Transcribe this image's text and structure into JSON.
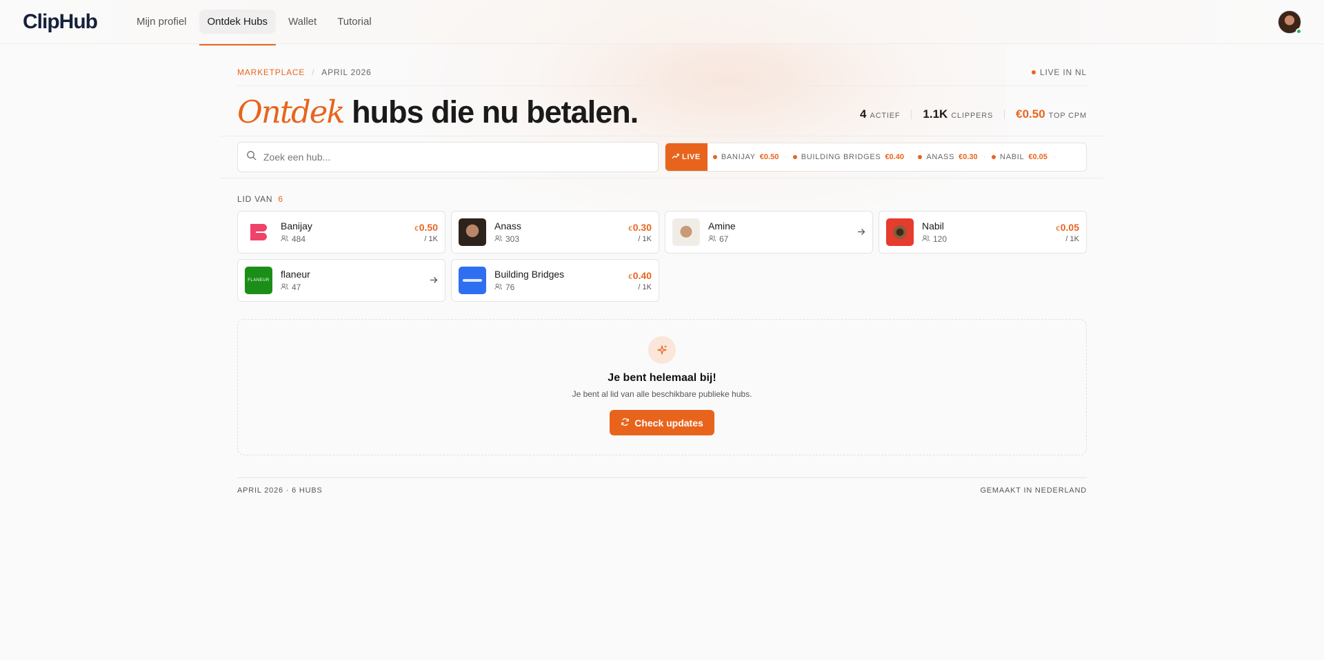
{
  "nav": {
    "logo": "ClipHub",
    "links": [
      "Mijn profiel",
      "Ontdek Hubs",
      "Wallet",
      "Tutorial"
    ],
    "active": "Ontdek Hubs"
  },
  "header": {
    "crumb_section": "MARKETPLACE",
    "crumb_date": "APRIL 2026",
    "live_label": "LIVE IN NL",
    "title_accent": "Ontdek",
    "title_rest": " hubs die nu betalen.",
    "stats": [
      {
        "value": "4",
        "label": "ACTIEF"
      },
      {
        "value": "1.1K",
        "label": "CLIPPERS"
      },
      {
        "value": "€0.50",
        "label": "TOP CPM"
      }
    ]
  },
  "search": {
    "placeholder": "Zoek een hub..."
  },
  "ticker": {
    "live_label": "LIVE",
    "items": [
      {
        "name": "BANIJAY",
        "price": "€0.50"
      },
      {
        "name": "BUILDING BRIDGES",
        "price": "€0.40"
      },
      {
        "name": "ANASS",
        "price": "€0.30"
      },
      {
        "name": "NABIL",
        "price": "€0.05"
      }
    ]
  },
  "membership": {
    "label": "LID VAN",
    "count": "6"
  },
  "hubs": [
    {
      "name": "Banijay",
      "members": "484",
      "currency": "€",
      "price": "0.50",
      "unit": "/ 1K",
      "icon": "banijay-logo"
    },
    {
      "name": "Anass",
      "members": "303",
      "currency": "€",
      "price": "0.30",
      "unit": "/ 1K",
      "icon": "avatar-photo"
    },
    {
      "name": "Amine",
      "members": "67",
      "currency": "",
      "price": "",
      "unit": "",
      "icon": "avatar-photo"
    },
    {
      "name": "Nabil",
      "members": "120",
      "currency": "€",
      "price": "0.05",
      "unit": "/ 1K",
      "icon": "avatar-photo"
    },
    {
      "name": "flaneur",
      "members": "47",
      "currency": "",
      "price": "",
      "unit": "",
      "icon": "flaneur-logo",
      "logo_text": "FLANEUR"
    },
    {
      "name": "Building Bridges",
      "members": "76",
      "currency": "€",
      "price": "0.40",
      "unit": "/ 1K",
      "icon": "building-bridges-logo",
      "logo_text": "BUILDING BRIDGES"
    }
  ],
  "empty_state": {
    "title": "Je bent helemaal bij!",
    "subtitle": "Je bent al lid van alle beschikbare publieke hubs.",
    "button": "Check updates"
  },
  "footer": {
    "left": "APRIL 2026 · 6 HUBS",
    "right": "GEMAAKT IN NEDERLAND"
  },
  "colors": {
    "accent": "#e8641d",
    "online": "#22b55a"
  }
}
